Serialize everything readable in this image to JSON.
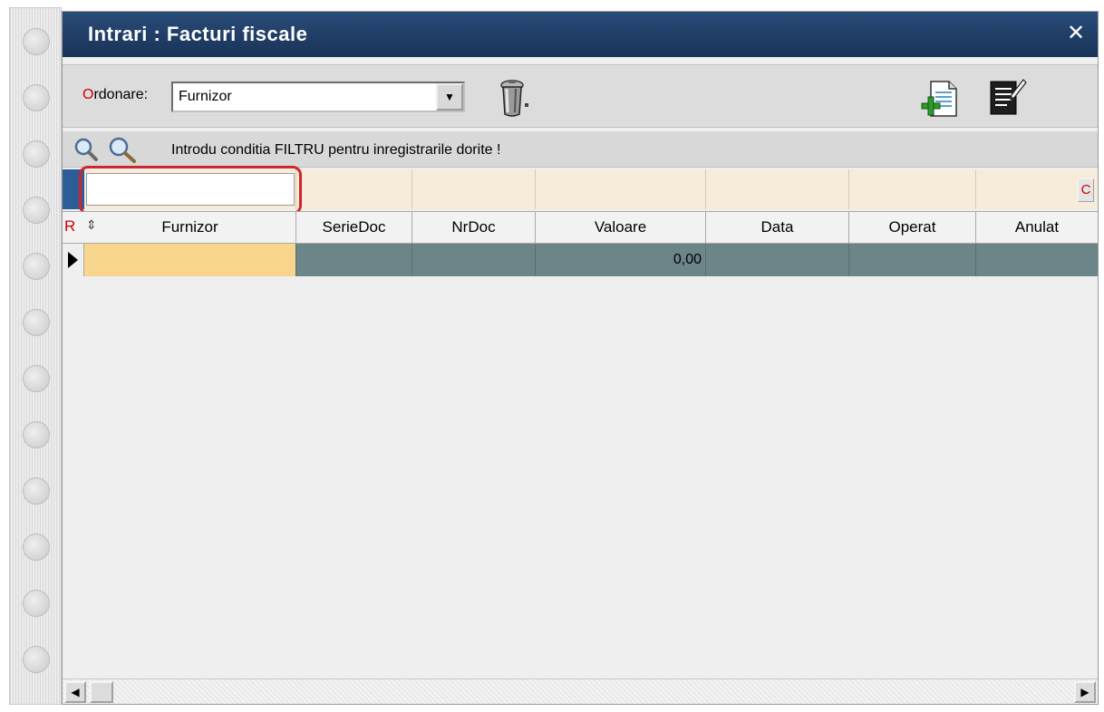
{
  "window": {
    "title": "Intrari : Facturi fiscale",
    "close_glyph": "✕"
  },
  "toolbar": {
    "ordonare_first": "O",
    "ordonare_rest": "rdonare:",
    "combo_value": "Furnizor",
    "combo_arrow": "▼",
    "icons": [
      "trash-icon",
      "add-document-icon",
      "edit-document-icon"
    ]
  },
  "filter": {
    "hint": "Introdu conditia FILTRU pentru inregistrarile dorite !",
    "input_value": "",
    "c_button": "C",
    "icons": [
      "search-icon",
      "search-advanced-icon"
    ]
  },
  "grid": {
    "r_marker": "R",
    "sort_glyph": "⇕",
    "columns": [
      "Furnizor",
      "SerieDoc",
      "NrDoc",
      "Valoare",
      "Data",
      "Operat",
      "Anulat"
    ],
    "rows": [
      [
        "",
        "",
        "",
        "0,00",
        "",
        "",
        ""
      ]
    ]
  },
  "scrollbar": {
    "left_arrow": "◀",
    "right_arrow": "▶"
  },
  "colors": {
    "titlebar": "#1f3c64",
    "selected_cell": "#f7d58c",
    "row_background": "#6c8589",
    "filter_row": "#f7ecd9",
    "highlight": "#d2242c"
  }
}
